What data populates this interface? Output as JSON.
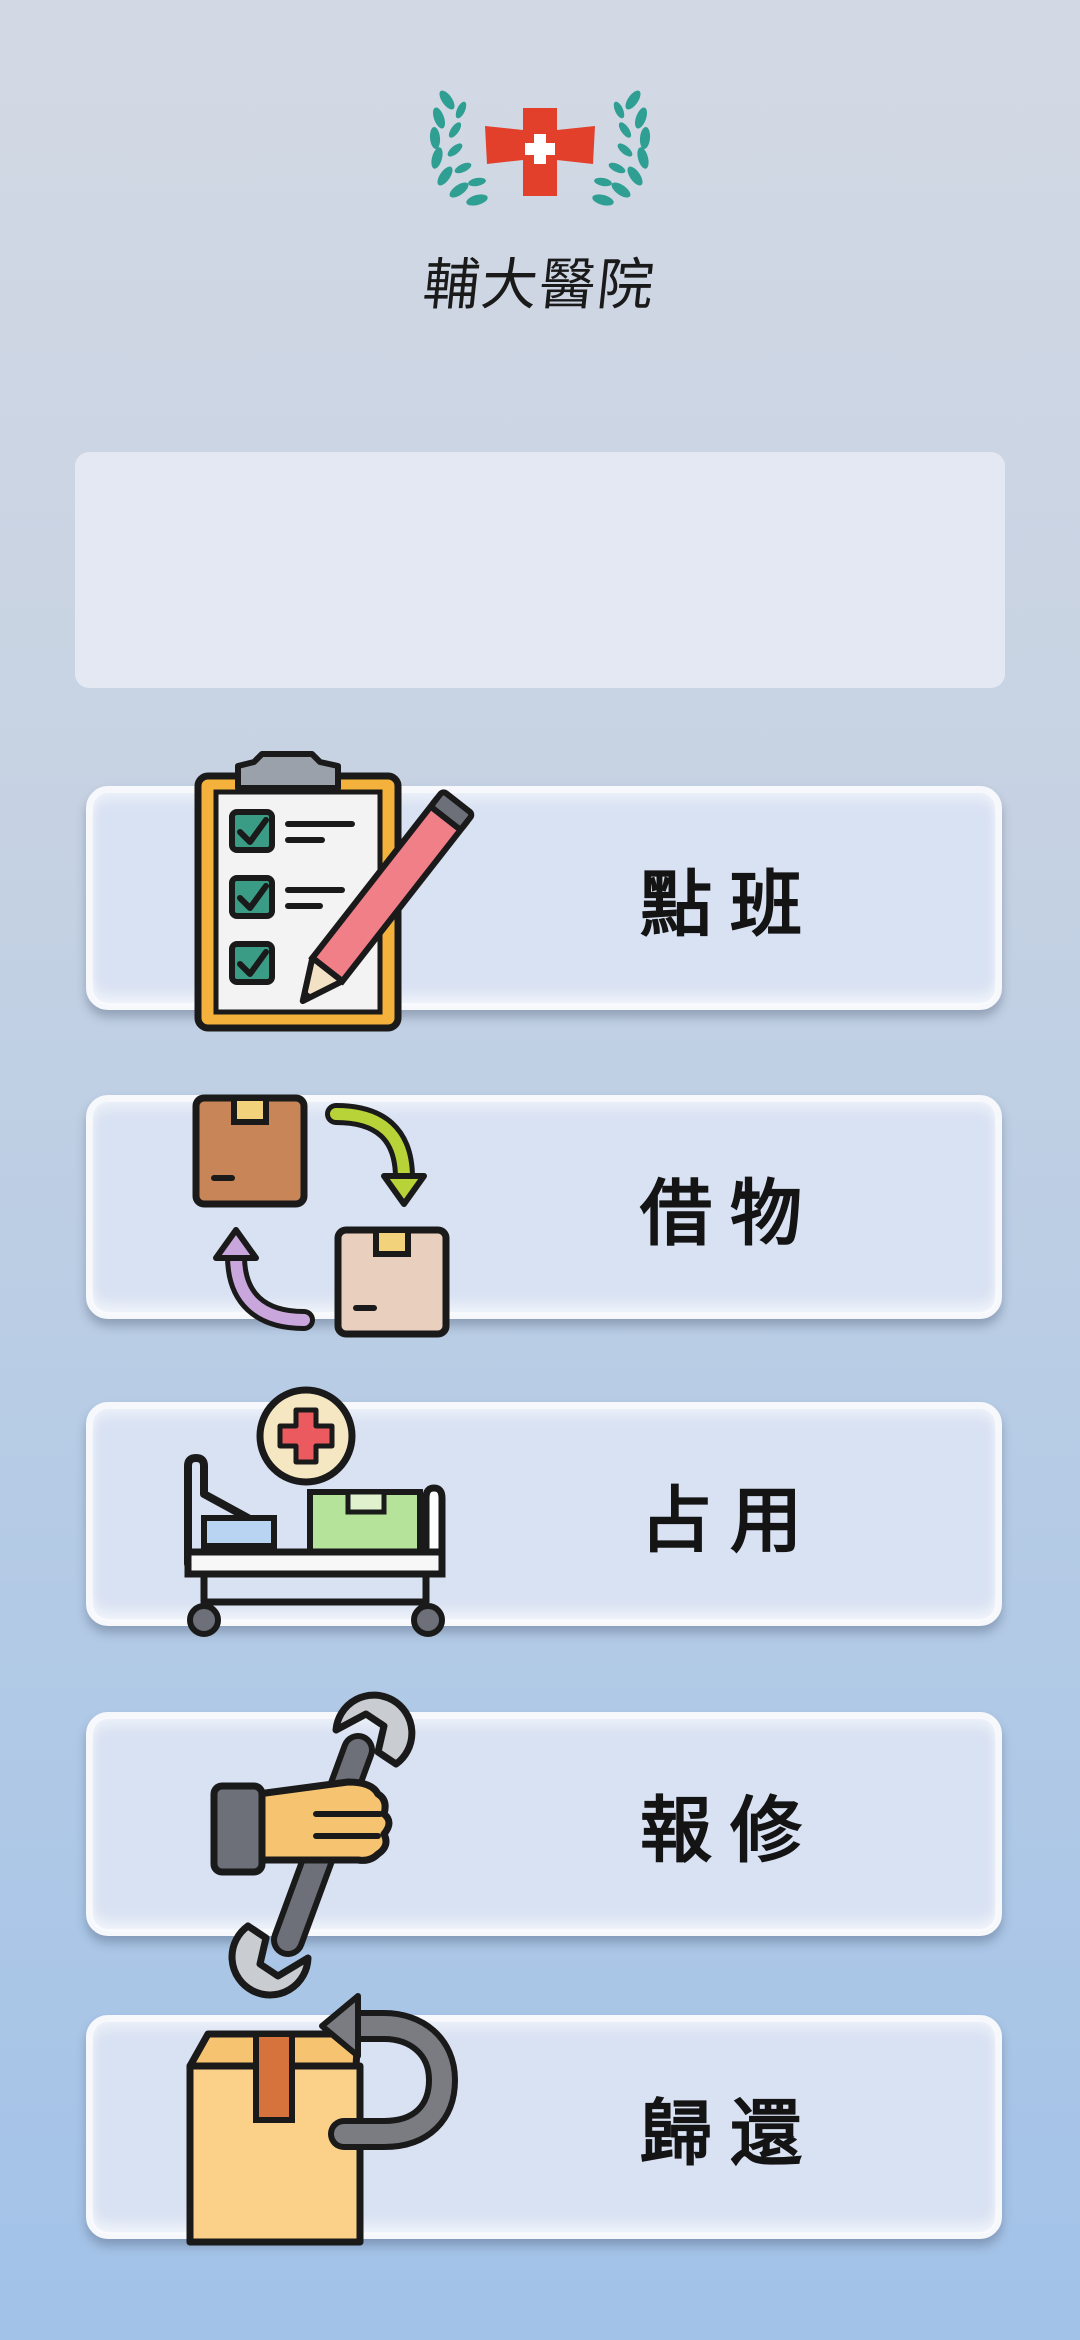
{
  "header": {
    "logo_text": "輔大醫院",
    "logo_icon": "red-cross-laurel-emblem"
  },
  "info_panel": {
    "text": ""
  },
  "menu": [
    {
      "label": "點班",
      "icon": "clipboard-checklist-icon"
    },
    {
      "label": "借物",
      "icon": "box-exchange-icon"
    },
    {
      "label": "占用",
      "icon": "hospital-bed-icon"
    },
    {
      "label": "報修",
      "icon": "wrench-hand-icon"
    },
    {
      "label": "歸還",
      "icon": "box-return-icon"
    }
  ],
  "colors": {
    "background_top": "#d3d9e4",
    "background_bottom": "#a2c2e8",
    "button_fill": "#d9e2f3",
    "cross_red": "#e2402b",
    "laurel_green": "#2f9f93"
  }
}
